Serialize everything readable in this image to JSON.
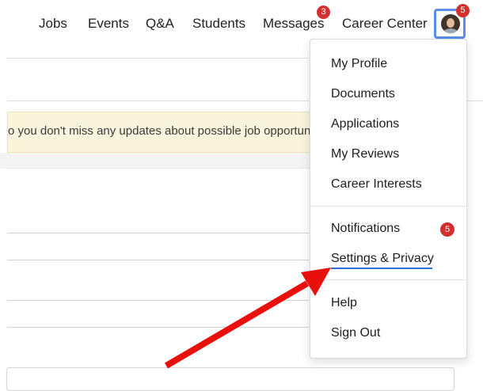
{
  "nav": {
    "items": [
      "Jobs",
      "Events",
      "Q&A",
      "Students",
      "Messages",
      "Career Center"
    ],
    "messages_badge": "3",
    "avatar_badge": "5"
  },
  "banner": {
    "text": "o you don't miss any updates about possible job opportunite"
  },
  "menu": {
    "section1": [
      "My Profile",
      "Documents",
      "Applications",
      "My Reviews",
      "Career Interests"
    ],
    "section2": [
      "Notifications",
      "Settings & Privacy"
    ],
    "section3": [
      "Help",
      "Sign Out"
    ],
    "notifications_badge": "5"
  },
  "colors": {
    "badge": "#d32f2f",
    "annotation_arrow": "#e8100d",
    "focus_ring": "#5b8def",
    "active_underline": "#2b6fd6",
    "banner_bg": "#fbf4dc"
  },
  "icons": {
    "avatar": "user-photo-avatar"
  }
}
